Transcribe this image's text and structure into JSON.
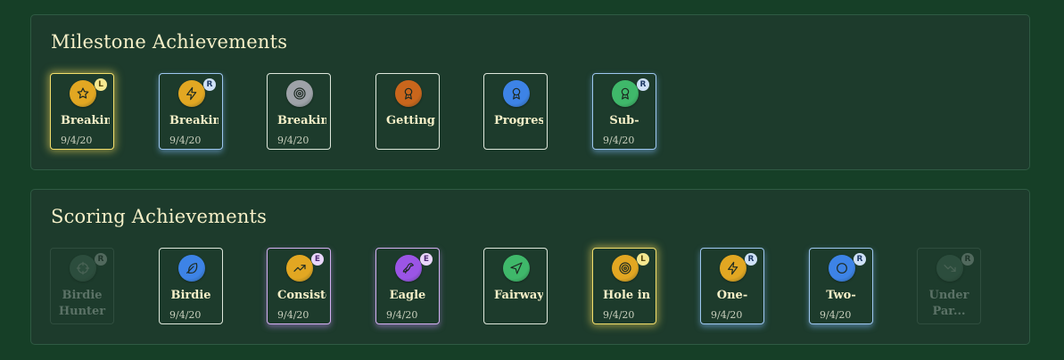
{
  "sections": [
    {
      "title": "Milestone Achievements",
      "cards": [
        {
          "name": "Breaking",
          "date": "9/4/20",
          "tier": "L",
          "icon": "star-icon",
          "color": "#e2a722",
          "locked": false
        },
        {
          "name": "Breaking",
          "date": "9/4/20",
          "tier": "R",
          "icon": "bolt-icon",
          "color": "#e2a722",
          "locked": false
        },
        {
          "name": "Breaking",
          "date": "9/4/20",
          "tier": "",
          "icon": "target-icon",
          "color": "#9ea2a8",
          "locked": false
        },
        {
          "name": "Getting",
          "date": "",
          "tier": "",
          "icon": "award-icon",
          "color": "#c9661c",
          "locked": false
        },
        {
          "name": "Progress",
          "date": "",
          "tier": "",
          "icon": "award-icon",
          "color": "#3d83e6",
          "locked": false
        },
        {
          "name": "Sub-",
          "date": "9/4/20",
          "tier": "R",
          "icon": "award-icon",
          "color": "#3fb86a",
          "locked": false
        }
      ]
    },
    {
      "title": "Scoring Achievements",
      "cards": [
        {
          "name": "Birdie Hunter",
          "date": "",
          "tier": "R",
          "icon": "crosshair-icon",
          "color": "#3a5c4b",
          "locked": true
        },
        {
          "name": "Birdie",
          "date": "9/4/20",
          "tier": "",
          "icon": "feather-icon",
          "color": "#3d83e6",
          "locked": false
        },
        {
          "name": "Consistent",
          "date": "9/4/20",
          "tier": "E",
          "icon": "trending-up-icon",
          "color": "#e2a722",
          "locked": false
        },
        {
          "name": "Eagle",
          "date": "9/4/20",
          "tier": "E",
          "icon": "bird-icon",
          "color": "#9b55e6",
          "locked": false
        },
        {
          "name": "Fairway",
          "date": "",
          "tier": "",
          "icon": "navigation-icon",
          "color": "#3fb86a",
          "locked": false
        },
        {
          "name": "Hole in",
          "date": "9/4/20",
          "tier": "L",
          "icon": "target-icon",
          "color": "#e2a722",
          "locked": false
        },
        {
          "name": "One-",
          "date": "9/4/20",
          "tier": "R",
          "icon": "bolt-icon",
          "color": "#e2a722",
          "locked": false
        },
        {
          "name": "Two-",
          "date": "9/4/20",
          "tier": "R",
          "icon": "circle-icon",
          "color": "#3d83e6",
          "locked": false
        },
        {
          "name": "Under Par...",
          "date": "",
          "tier": "R",
          "icon": "trending-down-icon",
          "color": "#3a5c4b",
          "locked": true
        }
      ]
    }
  ]
}
